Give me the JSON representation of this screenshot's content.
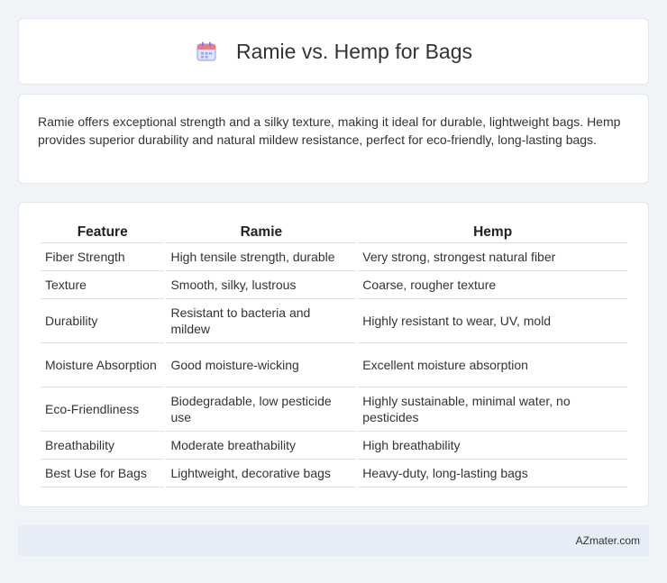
{
  "header": {
    "title": "Ramie vs. Hemp for Bags",
    "icon": "calendar-icon"
  },
  "summary": {
    "text": "Ramie offers exceptional strength and a silky texture, making it ideal for durable, lightweight bags. Hemp provides superior durability and natural mildew resistance, perfect for eco-friendly, long-lasting bags."
  },
  "table": {
    "headers": [
      "Feature",
      "Ramie",
      "Hemp"
    ],
    "rows": [
      [
        "Fiber Strength",
        "High tensile strength, durable",
        "Very strong, strongest natural fiber"
      ],
      [
        "Texture",
        "Smooth, silky, lustrous",
        "Coarse, rougher texture"
      ],
      [
        "Durability",
        "Resistant to bacteria and mildew",
        "Highly resistant to wear, UV, mold"
      ],
      [
        "Moisture Absorption",
        "Good moisture-wicking",
        "Excellent moisture absorption"
      ],
      [
        "Eco-Friendliness",
        "Biodegradable, low pesticide use",
        "Highly sustainable, minimal water, no pesticides"
      ],
      [
        "Breathability",
        "Moderate breathability",
        "High breathability"
      ],
      [
        "Best Use for Bags",
        "Lightweight, decorative bags",
        "Heavy-duty, long-lasting bags"
      ]
    ]
  },
  "footer": {
    "text": "AZmater.com"
  },
  "colors": {
    "page_bg": "#f0f3f8",
    "card_bg": "#ffffff",
    "footer_bg": "#e6edf7",
    "icon_accent": "#6d7ff0"
  }
}
